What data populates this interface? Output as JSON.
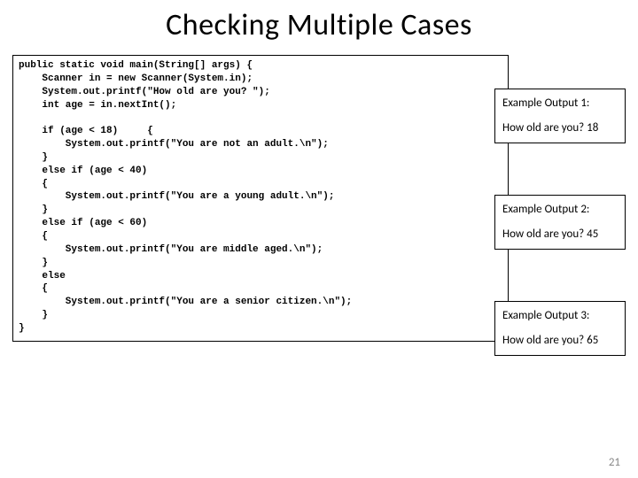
{
  "title": "Checking Multiple Cases",
  "code": "public static void main(String[] args) {\n    Scanner in = new Scanner(System.in);\n    System.out.printf(\"How old are you? \");\n    int age = in.nextInt();\n\n    if (age < 18)     {\n        System.out.printf(\"You are not an adult.\\n\");\n    }\n    else if (age < 40)\n    {\n        System.out.printf(\"You are a young adult.\\n\");\n    }\n    else if (age < 60)\n    {\n        System.out.printf(\"You are middle aged.\\n\");\n    }\n    else\n    {\n        System.out.printf(\"You are a senior citizen.\\n\");\n    }\n}",
  "examples": [
    {
      "header": "Example Output 1:",
      "body": "How old are you? 18"
    },
    {
      "header": "Example Output 2:",
      "body": "How old are you? 45"
    },
    {
      "header": "Example Output 3:",
      "body": "How old are you? 65"
    }
  ],
  "page_number": "21"
}
